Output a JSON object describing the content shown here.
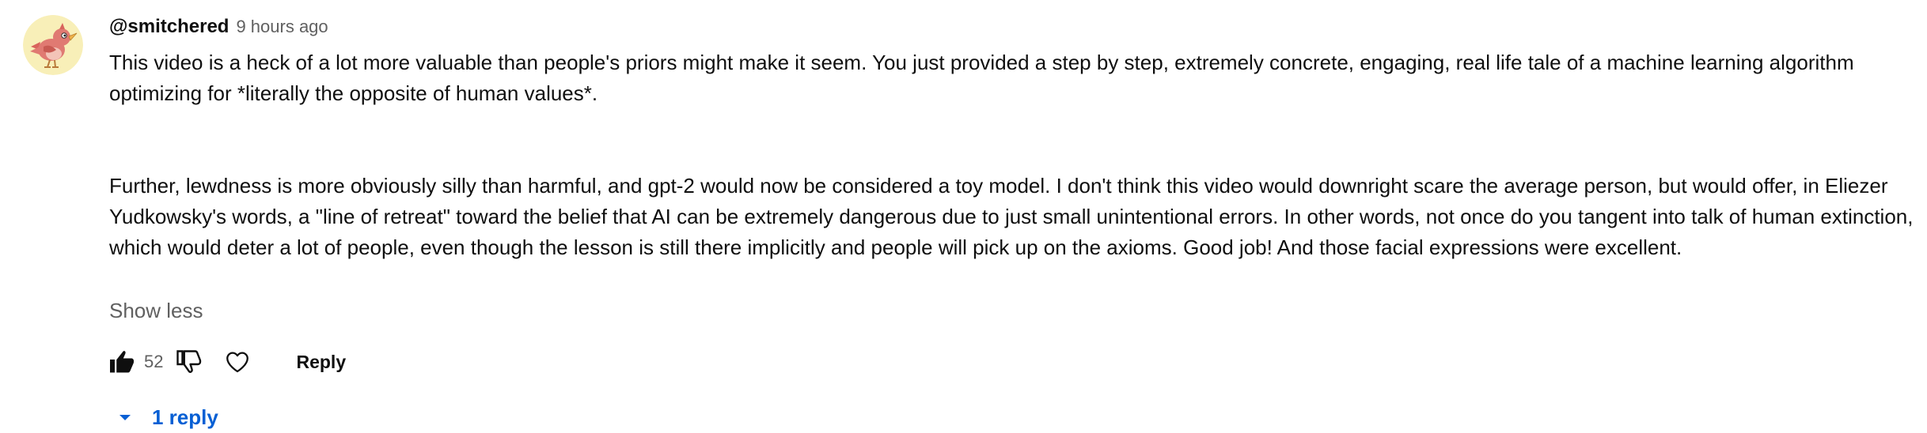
{
  "comment": {
    "author": "@smitchered",
    "timestamp": "9 hours ago",
    "avatar_icon": "cartoon-bird-avatar",
    "paragraphs": [
      "This video is a heck of a lot more valuable than people's priors might make it seem. You just provided a step by step, extremely concrete, engaging, real life tale of a machine learning algorithm optimizing for *literally the opposite of human values*.",
      "Further, lewdness is more obviously silly than harmful, and gpt-2 would now be considered a toy model. I don't think this video would downright scare the average person, but would offer, in Eliezer Yudkowsky's words, a \"line of retreat\" toward the belief that AI can be extremely dangerous due to just small unintentional errors. In other words, not once do you tangent into talk of human extinction, which would deter a lot of people, even though the lesson is still there implicitly and people will pick up on the axioms. Good job! And those facial expressions were excellent."
    ],
    "show_less_label": "Show less"
  },
  "actions": {
    "like_icon": "thumbs-up-filled-icon",
    "like_count": "52",
    "dislike_icon": "thumbs-down-icon",
    "heart_icon": "heart-icon",
    "reply_label": "Reply"
  },
  "replies": {
    "toggle_icon": "chevron-down-icon",
    "label": "1 reply"
  },
  "colors": {
    "text_primary": "#0f0f0f",
    "text_secondary": "#606060",
    "link_blue": "#065fd4",
    "avatar_bg": "#f8efb8",
    "bird_red": "#e07a72"
  }
}
